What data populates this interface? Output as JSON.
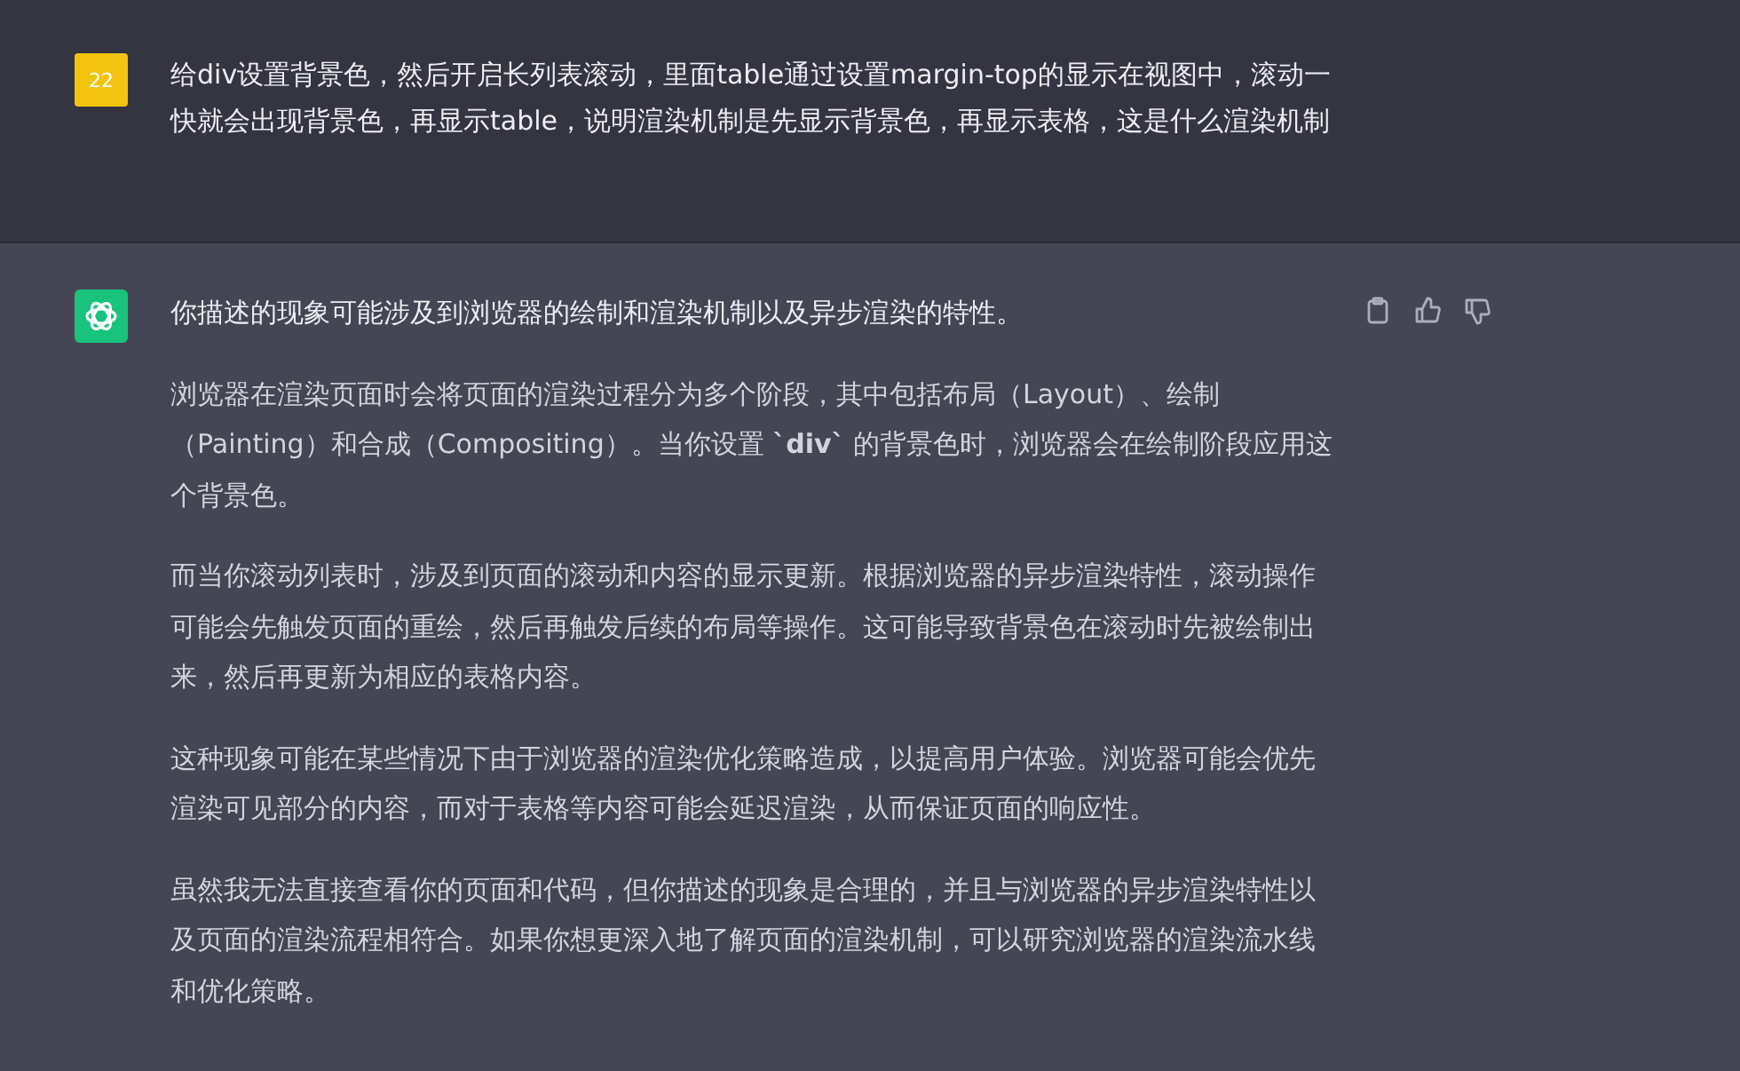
{
  "user_message": {
    "avatar": "22",
    "text": "给div设置背景色，然后开启长列表滚动，里面table通过设置margin-top的显示在视图中，滚动一快就会出现背景色，再显示table，说明渲染机制是先显示背景色，再显示表格，这是什么渲染机制"
  },
  "assistant_message": {
    "paragraphs": [
      "你描述的现象可能涉及到浏览器的绘制和渲染机制以及异步渲染的特性。",
      "浏览器在渲染页面时会将页面的渲染过程分为多个阶段，其中包括布局（Layout）、绘制（Painting）和合成（Compositing）。当你设置 **`div`** 的背景色时，浏览器会在绘制阶段应用这个背景色。",
      "而当你滚动列表时，涉及到页面的滚动和内容的显示更新。根据浏览器的异步渲染特性，滚动操作可能会先触发页面的重绘，然后再触发后续的布局等操作。这可能导致背景色在滚动时先被绘制出来，然后再更新为相应的表格内容。",
      "这种现象可能在某些情况下由于浏览器的渲染优化策略造成，以提高用户体验。浏览器可能会优先渲染可见部分的内容，而对于表格等内容可能会延迟渲染，从而保证页面的响应性。",
      "虽然我无法直接查看你的页面和代码，但你描述的现象是合理的，并且与浏览器的异步渲染特性以及页面的渲染流程相符合。如果你想更深入地了解页面的渲染机制，可以研究浏览器的渲染流水线和优化策略。"
    ]
  }
}
